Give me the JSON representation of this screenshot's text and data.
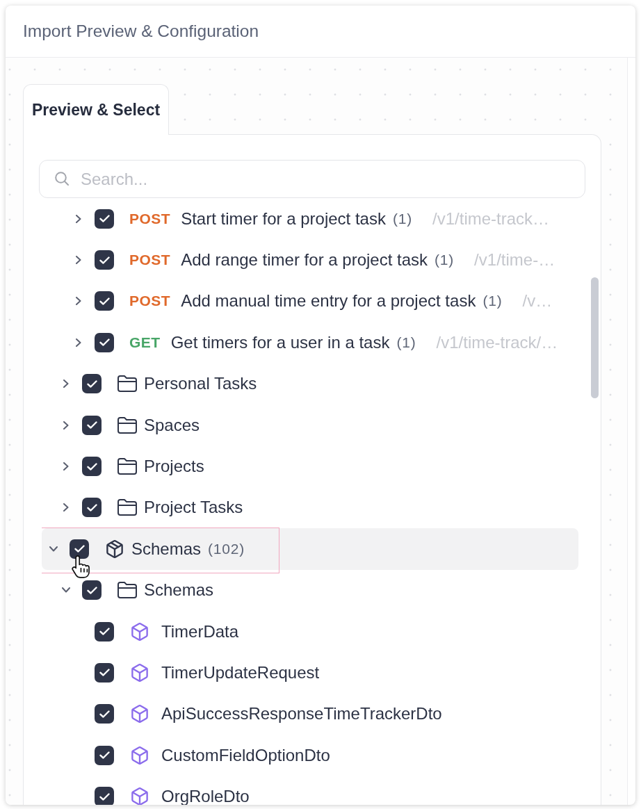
{
  "dialog": {
    "title": "Import Preview & Configuration"
  },
  "tabs": [
    {
      "label": "Preview & Select",
      "selected": true
    }
  ],
  "search": {
    "placeholder": "Search..."
  },
  "tree": [
    {
      "children": [
        {
          "children": [
            {
              "kind": "endpoint",
              "method": "POST",
              "color": "#e0692b",
              "label": "Start timer for a project task",
              "count": "(1)",
              "path": "/v1/time-track…",
              "checked": true,
              "expanded": false,
              "hovered": false
            },
            {
              "kind": "endpoint",
              "method": "POST",
              "color": "#e0692b",
              "label": "Add range timer for a project task",
              "count": "(1)",
              "path": "/v1/time-…",
              "checked": true,
              "expanded": false,
              "hovered": false
            },
            {
              "kind": "endpoint",
              "method": "POST",
              "color": "#e0692b",
              "label": "Add manual time entry for a project task",
              "count": "(1)",
              "path": "/v…",
              "checked": true,
              "expanded": false,
              "hovered": false
            },
            {
              "kind": "endpoint",
              "method": "GET",
              "color": "#48a567",
              "label": "Get timers for a user in a task",
              "count": "(1)",
              "path": "/v1/time-track/…",
              "checked": true,
              "expanded": false,
              "hovered": false
            }
          ]
        },
        {
          "kind": "folder",
          "label": "Personal Tasks",
          "checked": true,
          "expanded": false,
          "hovered": false
        },
        {
          "kind": "folder",
          "label": "Spaces",
          "checked": true,
          "expanded": false,
          "hovered": false
        },
        {
          "kind": "folder",
          "label": "Projects",
          "checked": true,
          "expanded": false,
          "hovered": false
        },
        {
          "kind": "folder",
          "label": "Project Tasks",
          "checked": true,
          "expanded": false,
          "hovered": false
        }
      ]
    },
    {
      "kind": "collection",
      "label": "Schemas",
      "count": "(102)",
      "checked": true,
      "expanded": true,
      "hovered": true,
      "children": [
        {
          "kind": "folder",
          "label": "Schemas",
          "checked": true,
          "expanded": true,
          "hovered": false,
          "children": [
            {
              "kind": "schema",
              "label": "TimerData",
              "checked": true,
              "hovered": false
            },
            {
              "kind": "schema",
              "label": "TimerUpdateRequest",
              "checked": true,
              "hovered": false
            },
            {
              "kind": "schema",
              "label": "ApiSuccessResponseTimeTrackerDto",
              "checked": true,
              "hovered": false
            },
            {
              "kind": "schema",
              "label": "CustomFieldOptionDto",
              "checked": true,
              "hovered": false
            },
            {
              "kind": "schema",
              "label": "OrgRoleDto",
              "checked": true,
              "hovered": false
            }
          ]
        }
      ]
    }
  ]
}
